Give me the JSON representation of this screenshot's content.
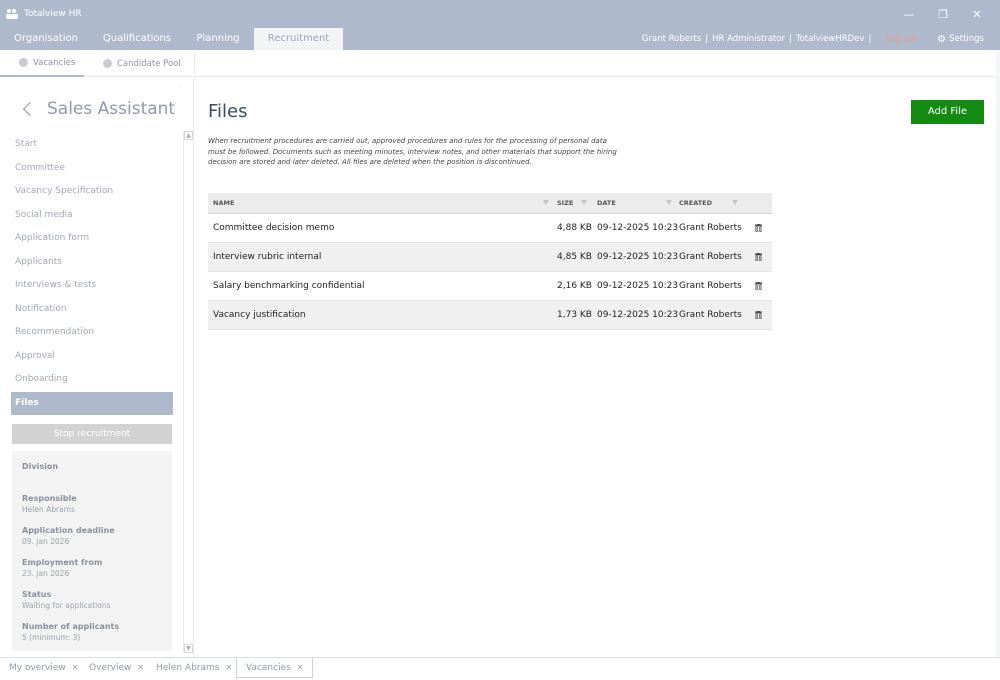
{
  "window": {
    "title": "Totalview HR",
    "controls": {
      "minimize": "—",
      "restore": "❐",
      "close": "✕"
    }
  },
  "topnav": {
    "tabs": [
      {
        "label": "Organisation"
      },
      {
        "label": "Qualifications"
      },
      {
        "label": "Planning"
      },
      {
        "label": "Recruitment"
      }
    ],
    "user": {
      "name": "Grant Roberts",
      "role": "HR Administrator",
      "environment": "TotalviewHRDev",
      "separator": "|",
      "logout": "Log out",
      "settings": "Settings"
    }
  },
  "subnav": {
    "tabs": [
      {
        "label": "Vacancies"
      },
      {
        "label": "Candidate Pool"
      }
    ]
  },
  "sidebar": {
    "vacancy_title": "Sales Assistant",
    "steps": [
      {
        "label": "Start"
      },
      {
        "label": "Committee"
      },
      {
        "label": "Vacancy Specification"
      },
      {
        "label": "Social media"
      },
      {
        "label": "Application form"
      },
      {
        "label": "Applicants"
      },
      {
        "label": "Interviews & tests"
      },
      {
        "label": "Notification"
      },
      {
        "label": "Recommendation"
      },
      {
        "label": "Approval"
      },
      {
        "label": "Onboarding"
      },
      {
        "label": "Files"
      }
    ],
    "stop_label": "Stop recruitment",
    "info": {
      "division_label": "Division",
      "responsible_label": "Responsible",
      "responsible_value": "Helen Abrams",
      "deadline_label": "Application deadline",
      "deadline_value": "09. jan 2026",
      "employment_label": "Employment from",
      "employment_value": "23. jan 2026",
      "status_label": "Status",
      "status_value": "Waiting for applications",
      "applicants_label": "Number of applicants",
      "applicants_value": "5 (minimum: 3)"
    }
  },
  "main": {
    "title": "Files",
    "add_label": "Add File",
    "description": "When recruitment procedures are carried out, approved procedures and rules for the processing of personal data must be followed. Documents such as meeting minutes, interview notes, and other materials that support the hiring decision are stored and later deleted. All files are deleted when the position is discontinued.",
    "table": {
      "headers": {
        "name": "NAME",
        "size": "SIZE",
        "date": "DATE",
        "created": "CREATED"
      },
      "rows": [
        {
          "name": "Committee decision memo",
          "size": "4,88 KB",
          "date": "09-12-2025 10:23",
          "created": "Grant Roberts"
        },
        {
          "name": "Interview rubric internal",
          "size": "4,85 KB",
          "date": "09-12-2025 10:23",
          "created": "Grant Roberts"
        },
        {
          "name": "Salary benchmarking confidential",
          "size": "2,16 KB",
          "date": "09-12-2025 10:23",
          "created": "Grant Roberts"
        },
        {
          "name": "Vacancy justification",
          "size": "1,73 KB",
          "date": "09-12-2025 10:23",
          "created": "Grant Roberts"
        }
      ]
    }
  },
  "bottom_tabs": [
    {
      "label": "My overview"
    },
    {
      "label": "Overview"
    },
    {
      "label": "Helen Abrams"
    },
    {
      "label": "Vacancies"
    }
  ],
  "colors": {
    "header": "#aeb9cb",
    "accent_green": "#138a12",
    "logout": "#f09a8e"
  }
}
